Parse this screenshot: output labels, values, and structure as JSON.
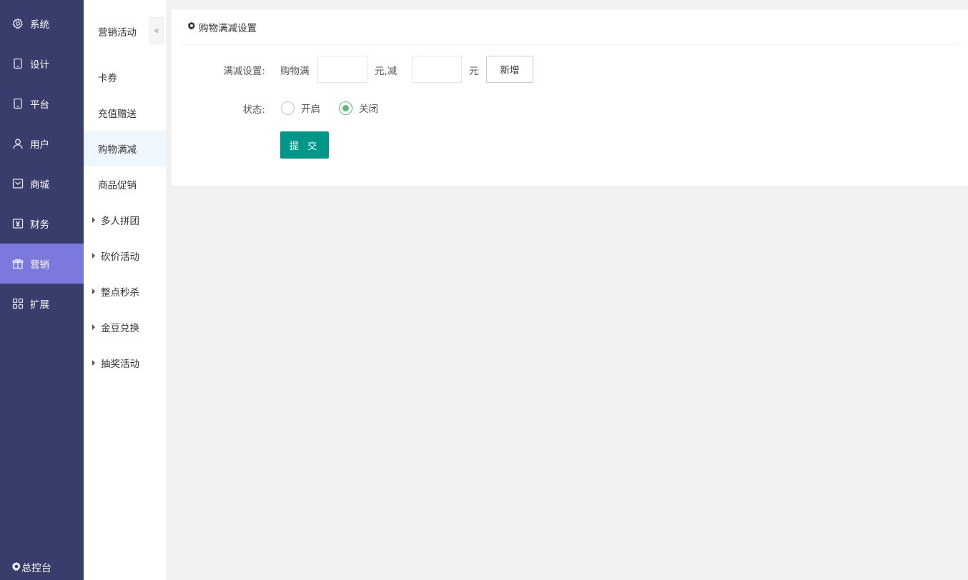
{
  "mainnav": {
    "items": [
      {
        "label": "系统",
        "icon": "gear-icon"
      },
      {
        "label": "设计",
        "icon": "tablet-icon"
      },
      {
        "label": "平台",
        "icon": "tablet-icon"
      },
      {
        "label": "用户",
        "icon": "user-icon"
      },
      {
        "label": "商城",
        "icon": "mail-icon"
      },
      {
        "label": "财务",
        "icon": "yen-icon"
      },
      {
        "label": "营销",
        "icon": "gift-icon"
      },
      {
        "label": "扩展",
        "icon": "grid-icon"
      }
    ],
    "active_index": 6,
    "bottom_label": "总控台",
    "bg_color": "#393d6b",
    "active_color": "#7b78de"
  },
  "subnav": {
    "title": "营销活动",
    "collapse_glyph": "«",
    "items": [
      {
        "label": "卡券"
      },
      {
        "label": "充值赠送"
      },
      {
        "label": "购物满减"
      },
      {
        "label": "商品促销"
      },
      {
        "label": "多人拼团"
      },
      {
        "label": "砍价活动"
      },
      {
        "label": "整点秒杀"
      },
      {
        "label": "金豆兑换"
      },
      {
        "label": "抽奖活动"
      }
    ],
    "active_index": 2
  },
  "panel": {
    "title": "购物满减设置",
    "rule": {
      "label": "满减设置:",
      "prefix": "购物满",
      "threshold_value": "",
      "middle": "元,减",
      "discount_value": "",
      "suffix": "元",
      "add_button": "新增"
    },
    "status": {
      "label": "状态:",
      "options": [
        {
          "label": "开启",
          "checked": false
        },
        {
          "label": "关闭",
          "checked": true
        }
      ]
    },
    "submit_button": "提 交",
    "submit_color": "#009688",
    "radio_color": "#5fb878"
  }
}
